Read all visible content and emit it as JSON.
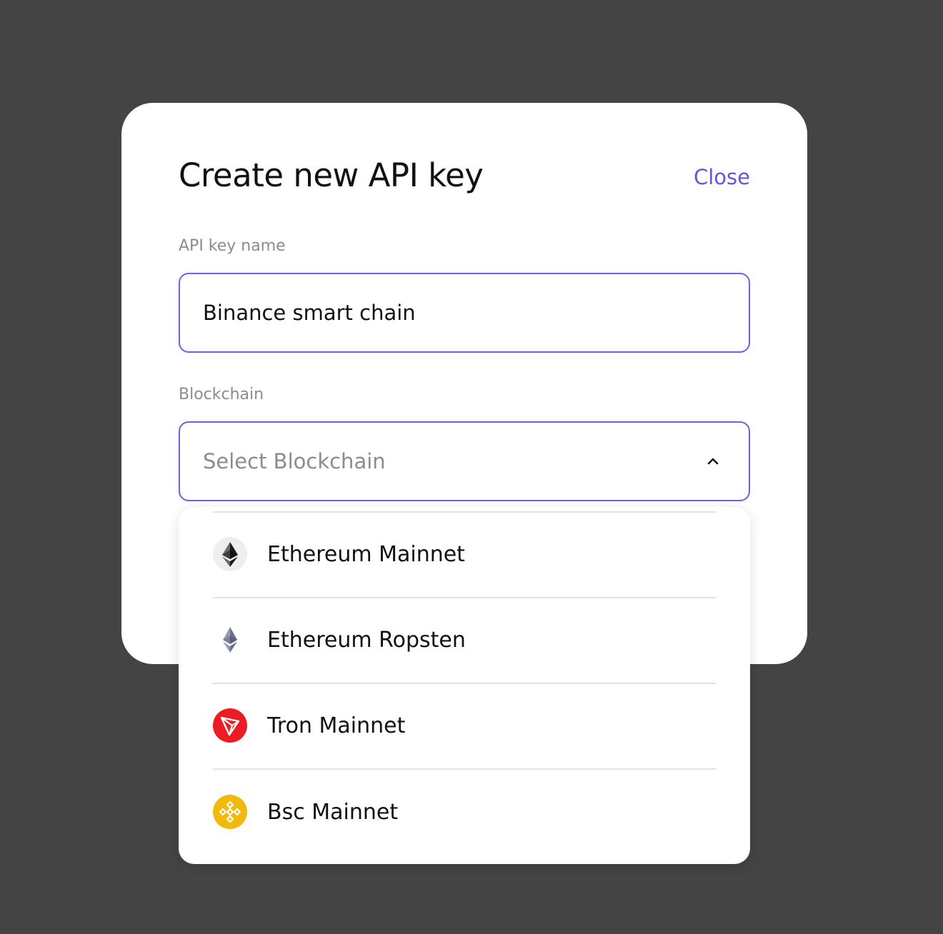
{
  "modal": {
    "title": "Create new API key",
    "close_label": "Close"
  },
  "form": {
    "api_key_name": {
      "label": "API key name",
      "value": "Binance smart chain"
    },
    "blockchain": {
      "label": "Blockchain",
      "placeholder": "Select Blockchain",
      "icon": "chevron-up-icon"
    }
  },
  "dropdown": {
    "options": [
      {
        "label": "Ethereum Mainnet",
        "icon": "ethereum-icon"
      },
      {
        "label": "Ethereum Ropsten",
        "icon": "ethereum-ropsten-icon"
      },
      {
        "label": "Tron Mainnet",
        "icon": "tron-icon"
      },
      {
        "label": "Bsc Mainnet",
        "icon": "bnb-icon"
      }
    ]
  },
  "colors": {
    "backdrop": "#444444",
    "accent": "#6e52dc",
    "field_border": "#7a5ce0",
    "tron_red": "#ec1c24",
    "bnb_yellow": "#f0b90b"
  }
}
